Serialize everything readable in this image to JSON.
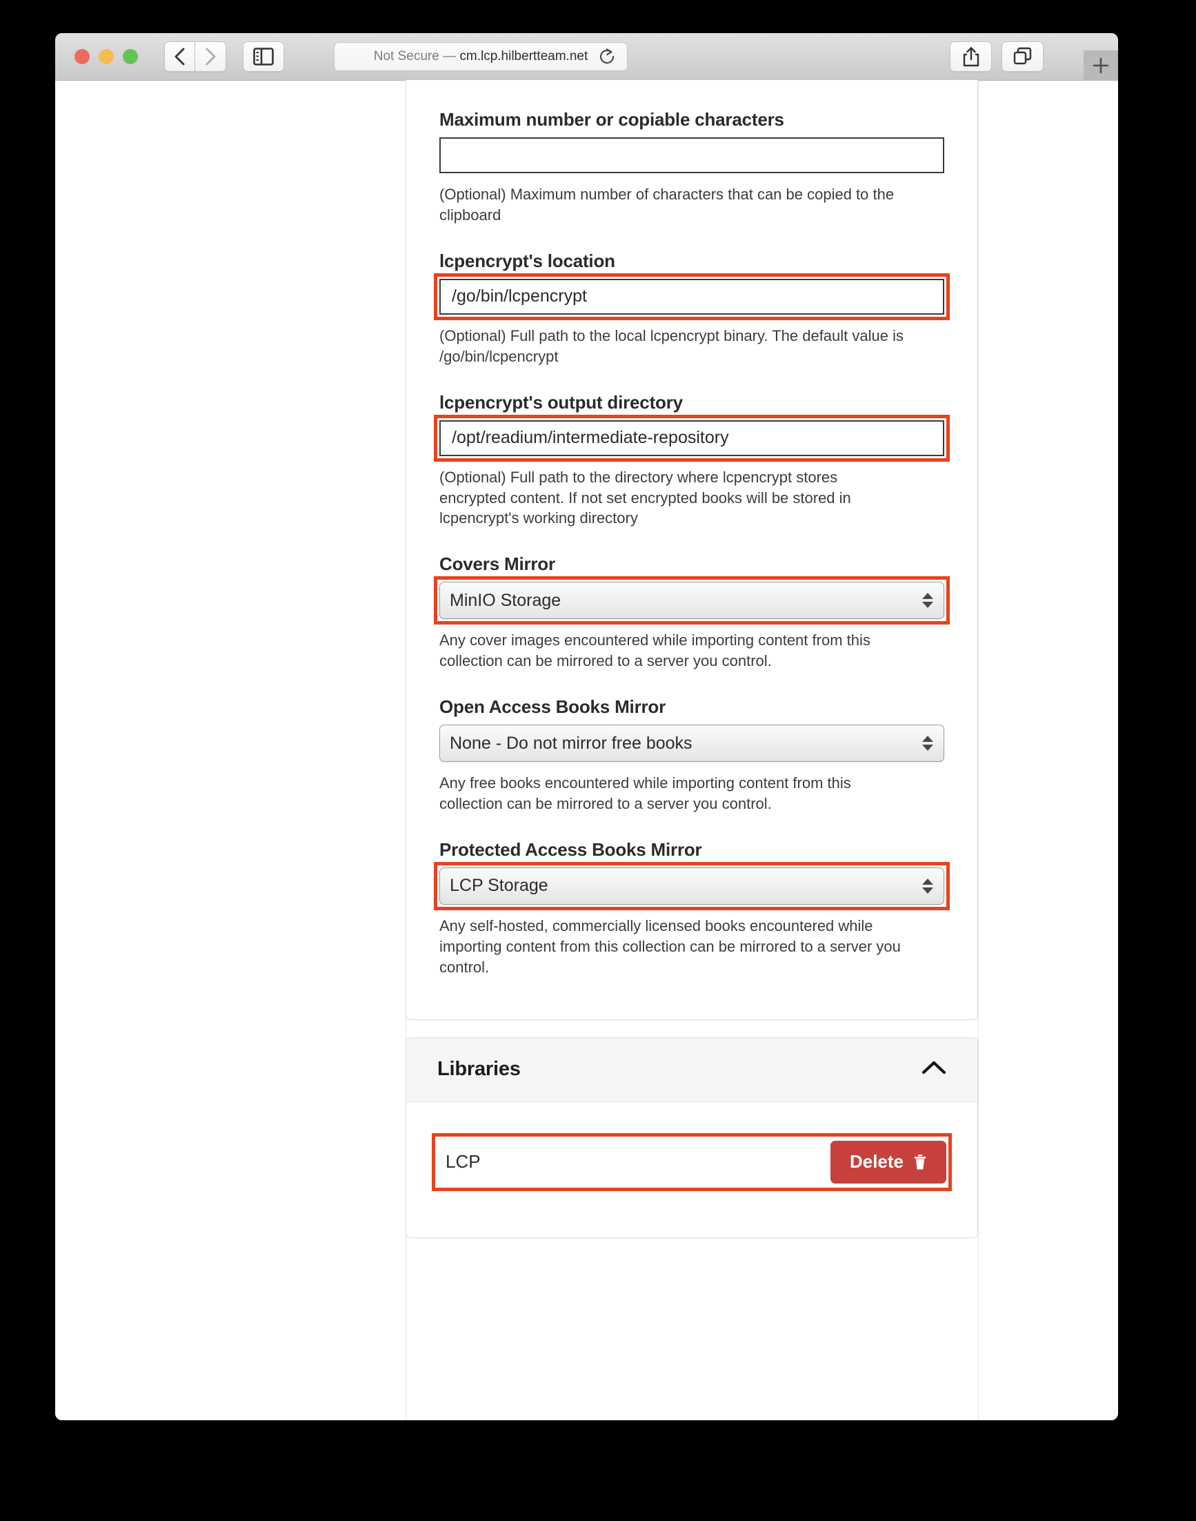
{
  "browser": {
    "address_insecure": "Not Secure",
    "address_separator": " — ",
    "address_host": "cm.lcp.hilbertteam.net",
    "back_icon": "back-chevron-icon",
    "forward_icon": "forward-chevron-icon",
    "sidebar_icon": "sidebar-toggle-icon",
    "reload_icon": "reload-icon",
    "share_icon": "share-icon",
    "tabs_icon": "tab-overview-icon",
    "newtab_label": "+"
  },
  "accent": {
    "highlight_red": "#E8421F",
    "delete_red": "#C6413C"
  },
  "form": {
    "fields": [
      {
        "label": "Maximum number or copiable characters",
        "value": "",
        "help": "(Optional) Maximum number of characters that can be copied to the clipboard"
      },
      {
        "label": "lcpencrypt's location",
        "value": "/go/bin/lcpencrypt",
        "help": "(Optional) Full path to the local lcpencrypt binary. The default value is /go/bin/lcpencrypt"
      },
      {
        "label": "lcpencrypt's output directory",
        "value": "/opt/readium/intermediate-repository",
        "help": "(Optional) Full path to the directory where lcpencrypt stores encrypted content. If not set encrypted books will be stored in lcpencrypt's working directory"
      }
    ],
    "selects": [
      {
        "label": "Covers Mirror",
        "value": "MinIO Storage",
        "help": "Any cover images encountered while importing content from this collection can be mirrored to a server you control."
      },
      {
        "label": "Open Access Books Mirror",
        "value": "None - Do not mirror free books",
        "help": "Any free books encountered while importing content from this collection can be mirrored to a server you control."
      },
      {
        "label": "Protected Access Books Mirror",
        "value": "LCP Storage",
        "help": "Any self-hosted, commercially licensed books encountered while importing content from this collection can be mirrored to a server you control."
      }
    ]
  },
  "libraries": {
    "title": "Libraries",
    "collapse_icon": "chevron-up-icon",
    "rows": [
      {
        "name": "LCP",
        "delete_label": "Delete",
        "delete_icon": "trash-icon"
      }
    ]
  }
}
